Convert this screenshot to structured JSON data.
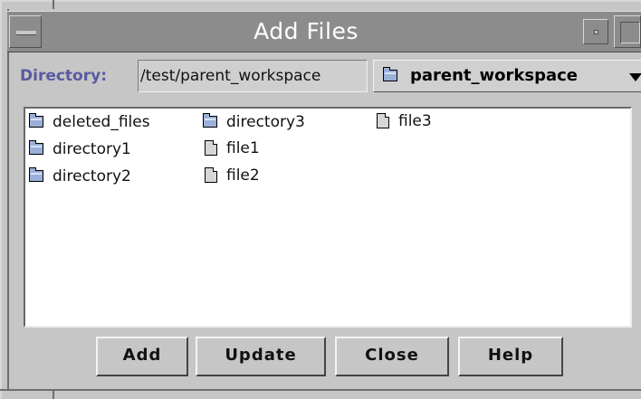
{
  "window": {
    "title": "Add Files"
  },
  "directory": {
    "label": "Directory:",
    "path_value": "/test/parent_workspace",
    "selected_folder": "parent_workspace"
  },
  "files": [
    {
      "name": "deleted_files",
      "kind": "folder",
      "icon": "folder-icon"
    },
    {
      "name": "directory1",
      "kind": "folder",
      "icon": "folder-icon"
    },
    {
      "name": "directory2",
      "kind": "folder",
      "icon": "folder-icon"
    },
    {
      "name": "directory3",
      "kind": "folder",
      "icon": "folder-icon"
    },
    {
      "name": "file1",
      "kind": "file",
      "icon": "file-icon"
    },
    {
      "name": "file2",
      "kind": "file",
      "icon": "file-icon"
    },
    {
      "name": "file3",
      "kind": "file",
      "icon": "file-icon"
    }
  ],
  "buttons": {
    "add": "Add",
    "update": "Update",
    "close": "Close",
    "help": "Help"
  },
  "colors": {
    "titlebar": "#8c8c8c",
    "background": "#c6c6c6",
    "label_accent": "#5a5aa0",
    "folder_fill": "#9ab0d8"
  }
}
